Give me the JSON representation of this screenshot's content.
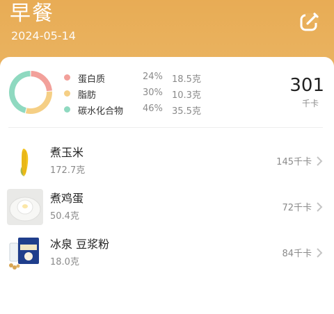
{
  "meal": {
    "title": "早餐",
    "date": "2024-05-14"
  },
  "icons": {
    "edit": "edit-icon",
    "chevron": "chevron-right-icon"
  },
  "colors": {
    "header": "#e8ac55",
    "protein": "#f2a09a",
    "fat": "#f5cf85",
    "carbs": "#8fd9c0"
  },
  "nutrition": {
    "total_kcal": "301",
    "kcal_unit": "千卡",
    "macros": [
      {
        "name": "蛋白质",
        "percent": "24%",
        "grams": "18.5克",
        "color": "#f2a09a",
        "share": 0.24
      },
      {
        "name": "脂肪",
        "percent": "30%",
        "grams": "10.3克",
        "color": "#f5cf85",
        "share": 0.3
      },
      {
        "name": "碳水化合物",
        "percent": "46%",
        "grams": "35.5克",
        "color": "#8fd9c0",
        "share": 0.46
      }
    ]
  },
  "foods": [
    {
      "name": "煮玉米",
      "weight": "172.7克",
      "kcal": "145千卡"
    },
    {
      "name": "煮鸡蛋",
      "weight": "50.4克",
      "kcal": "72千卡"
    },
    {
      "name": "冰泉 豆浆粉",
      "weight": "18.0克",
      "kcal": "84千卡"
    }
  ]
}
